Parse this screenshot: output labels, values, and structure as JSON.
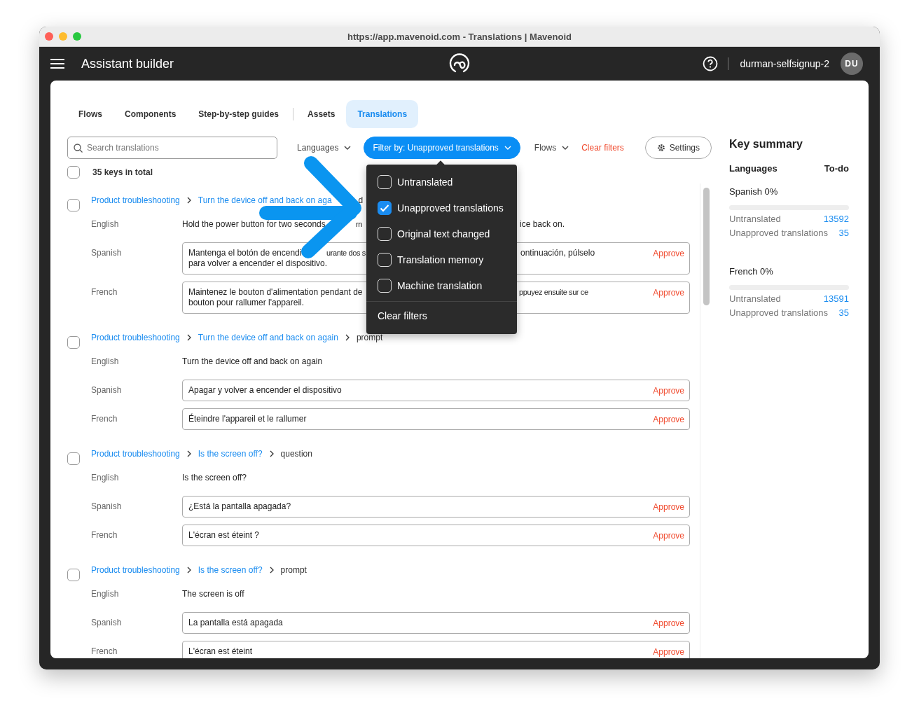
{
  "browser": {
    "title": "https://app.mavenoid.com - Translations | Mavenoid"
  },
  "app_bar": {
    "title": "Assistant builder",
    "user": "durman-selfsignup-2",
    "avatar": "DU"
  },
  "tab_groups": [
    [
      {
        "label": "Flows",
        "selected": false
      },
      {
        "label": "Components",
        "selected": false
      },
      {
        "label": "Step-by-step guides",
        "selected": false
      }
    ],
    [
      {
        "label": "Assets",
        "selected": false
      },
      {
        "label": "Translations",
        "selected": true
      }
    ]
  ],
  "toolbar": {
    "search": {
      "placeholder": "Search translations"
    },
    "languages": "Languages",
    "filter": {
      "label": "Filter by: Unapproved translations",
      "open": true
    },
    "flows": "Flows",
    "clear": "Clear filters",
    "settings": "Settings"
  },
  "filter_menu": {
    "options": [
      {
        "label": "Untranslated",
        "checked": false
      },
      {
        "label": "Unapproved translations",
        "checked": true
      },
      {
        "label": "Original text changed",
        "checked": false
      },
      {
        "label": "Translation memory",
        "checked": false
      },
      {
        "label": "Machine translation",
        "checked": false
      }
    ],
    "clear": "Clear filters"
  },
  "total": {
    "label": "35 keys in total",
    "checked": false
  },
  "entries": [
    {
      "kind": "partial",
      "checked": false,
      "breadcrumb": [
        {
          "text": "Product troubleshooting",
          "link": true
        },
        {
          "text": "Turn the device off and back on aga",
          "link": true
        },
        {
          "text": "d",
          "link": false
        }
      ],
      "rows": [
        {
          "language": "English",
          "boxed": false,
          "lines": [
            [
              "Hold the power button for two seconds",
              "rn",
              "ice back on."
            ]
          ]
        },
        {
          "language": "Spanish",
          "boxed": true,
          "approve": "Approve",
          "lines": [
            [
              "Mantenga el botón de encendi",
              "urante dos s",
              "ontinuación, púlselo"
            ],
            [
              "para volver a encender el dispositivo."
            ]
          ]
        },
        {
          "language": "French",
          "boxed": true,
          "approve": "Approve",
          "lines": [
            [
              "Maintenez le bouton d'alimentation pendant de",
              "ppuyez ensuite sur ce"
            ],
            [
              "bouton pour rallumer l'appareil."
            ]
          ]
        }
      ]
    },
    {
      "kind": "full",
      "checked": false,
      "breadcrumb": [
        {
          "text": "Product troubleshooting",
          "link": true
        },
        {
          "text": "Turn the device off and back on again",
          "link": true
        },
        {
          "text": "prompt",
          "link": false
        }
      ],
      "rows": [
        {
          "language": "English",
          "boxed": false,
          "lines": [
            [
              "Turn the device off and back on again"
            ]
          ]
        },
        {
          "language": "Spanish",
          "boxed": true,
          "approve": "Approve",
          "lines": [
            [
              "Apagar y volver a encender el dispositivo"
            ]
          ]
        },
        {
          "language": "French",
          "boxed": true,
          "approve": "Approve",
          "lines": [
            [
              "Éteindre l'appareil et le rallumer"
            ]
          ]
        }
      ]
    },
    {
      "kind": "full",
      "checked": false,
      "breadcrumb": [
        {
          "text": "Product troubleshooting",
          "link": true
        },
        {
          "text": "Is the screen off?",
          "link": true
        },
        {
          "text": "question",
          "link": false
        }
      ],
      "rows": [
        {
          "language": "English",
          "boxed": false,
          "lines": [
            [
              "Is the screen off?"
            ]
          ]
        },
        {
          "language": "Spanish",
          "boxed": true,
          "approve": "Approve",
          "lines": [
            [
              "¿Está la pantalla apagada?"
            ]
          ]
        },
        {
          "language": "French",
          "boxed": true,
          "approve": "Approve",
          "lines": [
            [
              "L'écran est éteint ?"
            ]
          ]
        }
      ]
    },
    {
      "kind": "full",
      "checked": false,
      "breadcrumb": [
        {
          "text": "Product troubleshooting",
          "link": true
        },
        {
          "text": "Is the screen off?",
          "link": true
        },
        {
          "text": "prompt",
          "link": false
        }
      ],
      "rows": [
        {
          "language": "English",
          "boxed": false,
          "lines": [
            [
              "The screen is off"
            ]
          ]
        },
        {
          "language": "Spanish",
          "boxed": true,
          "approve": "Approve",
          "lines": [
            [
              "La pantalla está apagada"
            ]
          ]
        },
        {
          "language": "French",
          "boxed": true,
          "approve": "Approve",
          "lines": [
            [
              "L'écran est éteint"
            ]
          ]
        }
      ]
    }
  ],
  "summary": {
    "title": "Key summary",
    "headers": [
      "Languages",
      "To-do"
    ],
    "languages": [
      {
        "name": "Spanish 0%",
        "level": 0,
        "stats": [
          {
            "label": "Untranslated",
            "value": "13592"
          },
          {
            "label": "Unapproved translations",
            "value": "35"
          }
        ]
      },
      {
        "name": "French 0%",
        "level": 0,
        "stats": [
          {
            "label": "Untranslated",
            "value": "13591"
          },
          {
            "label": "Unapproved translations",
            "value": "35"
          }
        ]
      }
    ]
  }
}
